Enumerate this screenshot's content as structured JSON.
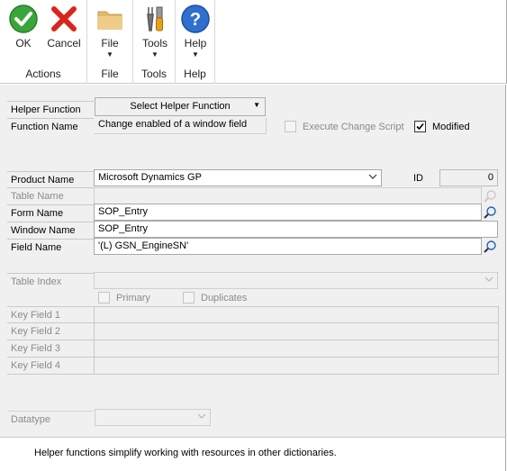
{
  "ribbon": {
    "actions": {
      "label": "Actions",
      "ok": "OK",
      "cancel": "Cancel"
    },
    "file": {
      "label": "File",
      "button": "File"
    },
    "tools": {
      "label": "Tools",
      "button": "Tools"
    },
    "help": {
      "label": "Help",
      "button": "Help",
      "glyph": "?"
    }
  },
  "form": {
    "helper_function_label": "Helper Function",
    "helper_function_button": "Select Helper Function",
    "function_name_label": "Function Name",
    "function_name_value": "Change enabled of a window field",
    "execute_change_script": "Execute Change Script",
    "modified": "Modified",
    "product_name_label": "Product Name",
    "product_name_value": "Microsoft Dynamics GP",
    "id_label": "ID",
    "id_value": "0",
    "table_name_label": "Table Name",
    "form_name_label": "Form Name",
    "form_name_value": "SOP_Entry",
    "window_name_label": "Window Name",
    "window_name_value": "SOP_Entry",
    "field_name_label": "Field Name",
    "field_name_value": "'(L) GSN_EngineSN'",
    "table_index_label": "Table Index",
    "primary": "Primary",
    "duplicates": "Duplicates",
    "key_fields": [
      "Key Field 1",
      "Key Field 2",
      "Key Field 3",
      "Key Field 4"
    ],
    "datatype_label": "Datatype"
  },
  "status_text": "Helper functions simplify working with resources in other dictionaries."
}
